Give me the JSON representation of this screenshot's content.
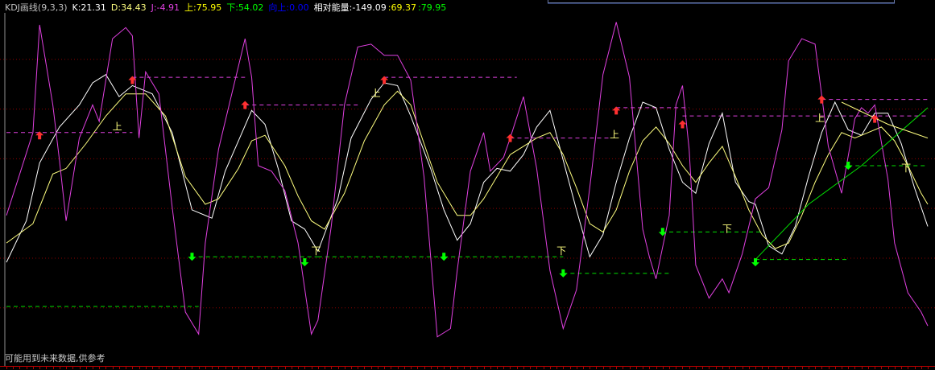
{
  "header": {
    "indicator": "KDJ画线(9,3,3)",
    "k": "K:21.31",
    "d": "D:34.43",
    "j": "J:-4.91",
    "up": "上:75.95",
    "down": "下:54.02",
    "upward": "向上:0.00",
    "rel_energy": "相对能量:-149.09",
    "rel_val2": ":69.37",
    "rel_val3": ":79.95"
  },
  "footer": "可能用到未来数据,供参考",
  "colors": {
    "background": "#000000",
    "header_name": "#c0c0c0",
    "k": "#ffffff",
    "d": "#ffff80",
    "j": "#e040e0",
    "up": "#ffff00",
    "down": "#00ff00",
    "upward": "#0000ff",
    "rel1": "#ffffff",
    "rel2": "#ffff00",
    "rel3": "#00ff00",
    "grid": "#8a0000",
    "peak_marker": "#ff3030",
    "trough_marker": "#00ff00",
    "peak_level": "#e040e0",
    "trough_level": "#00e000",
    "label_text": "#ffff80"
  },
  "chart_data": {
    "type": "line",
    "title": "KDJ画线(9,3,3)",
    "ylim": [
      -16,
      118
    ],
    "grid": true,
    "n_points": 140,
    "gridlines": [
      96.5,
      78.5,
      60.5,
      42.5,
      24.5,
      6.5
    ],
    "series": [
      {
        "name": "K",
        "points": [
          [
            0,
            23
          ],
          [
            3,
            38
          ],
          [
            5,
            59
          ],
          [
            8,
            72
          ],
          [
            11,
            80
          ],
          [
            13,
            88
          ],
          [
            15,
            91
          ],
          [
            17,
            83
          ],
          [
            19,
            87
          ],
          [
            22,
            84
          ],
          [
            25,
            70
          ],
          [
            28,
            42
          ],
          [
            31,
            39
          ],
          [
            33,
            56
          ],
          [
            35,
            67
          ],
          [
            37,
            78
          ],
          [
            39,
            73
          ],
          [
            41,
            57
          ],
          [
            43,
            38
          ],
          [
            45,
            35
          ],
          [
            47,
            27
          ],
          [
            50,
            46
          ],
          [
            52,
            68
          ],
          [
            55,
            82
          ],
          [
            57,
            88
          ],
          [
            59,
            87
          ],
          [
            61,
            76
          ],
          [
            64,
            57
          ],
          [
            66,
            42
          ],
          [
            68,
            31
          ],
          [
            70,
            37
          ],
          [
            72,
            52
          ],
          [
            74,
            57
          ],
          [
            76,
            56
          ],
          [
            78,
            62
          ],
          [
            80,
            72
          ],
          [
            82,
            78
          ],
          [
            84,
            60
          ],
          [
            86,
            42
          ],
          [
            88,
            25
          ],
          [
            90,
            33
          ],
          [
            92,
            52
          ],
          [
            94,
            68
          ],
          [
            96,
            81
          ],
          [
            98,
            79
          ],
          [
            100,
            64
          ],
          [
            102,
            52
          ],
          [
            104,
            48
          ],
          [
            106,
            66
          ],
          [
            108,
            77
          ],
          [
            110,
            52
          ],
          [
            112,
            45
          ],
          [
            113,
            44
          ],
          [
            115,
            29
          ],
          [
            117,
            26
          ],
          [
            119,
            36
          ],
          [
            121,
            54
          ],
          [
            123,
            70
          ],
          [
            125,
            81
          ],
          [
            127,
            71
          ],
          [
            129,
            69
          ],
          [
            131,
            77
          ],
          [
            133,
            77
          ],
          [
            135,
            66
          ],
          [
            137,
            50
          ],
          [
            139,
            36
          ]
        ]
      },
      {
        "name": "D",
        "points": [
          [
            0,
            30
          ],
          [
            4,
            37
          ],
          [
            7,
            55
          ],
          [
            9,
            57
          ],
          [
            12,
            66
          ],
          [
            15,
            76
          ],
          [
            18,
            84
          ],
          [
            21,
            84
          ],
          [
            24,
            76
          ],
          [
            27,
            54
          ],
          [
            30,
            44
          ],
          [
            32,
            46
          ],
          [
            35,
            57
          ],
          [
            37,
            67
          ],
          [
            39,
            69
          ],
          [
            42,
            58
          ],
          [
            44,
            47
          ],
          [
            46,
            38
          ],
          [
            48,
            35
          ],
          [
            51,
            48
          ],
          [
            54,
            67
          ],
          [
            57,
            80
          ],
          [
            59,
            85
          ],
          [
            61,
            80
          ],
          [
            63,
            66
          ],
          [
            65,
            52
          ],
          [
            68,
            40
          ],
          [
            70,
            40
          ],
          [
            72,
            46
          ],
          [
            74,
            54
          ],
          [
            76,
            62
          ],
          [
            78,
            65
          ],
          [
            80,
            68
          ],
          [
            82,
            70
          ],
          [
            84,
            62
          ],
          [
            86,
            50
          ],
          [
            88,
            37
          ],
          [
            90,
            34
          ],
          [
            92,
            42
          ],
          [
            94,
            56
          ],
          [
            96,
            67
          ],
          [
            98,
            72
          ],
          [
            100,
            66
          ],
          [
            102,
            58
          ],
          [
            104,
            52
          ],
          [
            106,
            59
          ],
          [
            108,
            65
          ],
          [
            110,
            54
          ],
          [
            112,
            42
          ],
          [
            114,
            33
          ],
          [
            116,
            28
          ],
          [
            118,
            30
          ],
          [
            120,
            40
          ],
          [
            122,
            52
          ],
          [
            124,
            62
          ],
          [
            126,
            70
          ],
          [
            128,
            68
          ],
          [
            130,
            70
          ],
          [
            132,
            72
          ],
          [
            134,
            67
          ],
          [
            136,
            58
          ],
          [
            138,
            48
          ],
          [
            139,
            44
          ]
        ]
      },
      {
        "name": "J",
        "points": [
          [
            0,
            40
          ],
          [
            2,
            55
          ],
          [
            4,
            70
          ],
          [
            5,
            109
          ],
          [
            7,
            80
          ],
          [
            8,
            60
          ],
          [
            9,
            38
          ],
          [
            11,
            68
          ],
          [
            13,
            80
          ],
          [
            14,
            74
          ],
          [
            16,
            104
          ],
          [
            18,
            108
          ],
          [
            19,
            105
          ],
          [
            20,
            68
          ],
          [
            21,
            92
          ],
          [
            23,
            84
          ],
          [
            25,
            43
          ],
          [
            27,
            5
          ],
          [
            29,
            -3
          ],
          [
            30,
            30
          ],
          [
            32,
            64
          ],
          [
            34,
            84
          ],
          [
            36,
            104
          ],
          [
            37,
            90
          ],
          [
            38,
            58
          ],
          [
            40,
            56
          ],
          [
            42,
            49
          ],
          [
            44,
            30
          ],
          [
            46,
            -3
          ],
          [
            47,
            2
          ],
          [
            49,
            36
          ],
          [
            51,
            80
          ],
          [
            53,
            101
          ],
          [
            55,
            102
          ],
          [
            57,
            98
          ],
          [
            59,
            98
          ],
          [
            61,
            89
          ],
          [
            63,
            54
          ],
          [
            65,
            -4
          ],
          [
            67,
            -1
          ],
          [
            68,
            20
          ],
          [
            70,
            56
          ],
          [
            72,
            70
          ],
          [
            73,
            56
          ],
          [
            75,
            61
          ],
          [
            76,
            68
          ],
          [
            78,
            83
          ],
          [
            80,
            57
          ],
          [
            82,
            20
          ],
          [
            84,
            -1
          ],
          [
            86,
            13
          ],
          [
            88,
            50
          ],
          [
            90,
            91
          ],
          [
            92,
            110
          ],
          [
            94,
            90
          ],
          [
            96,
            35
          ],
          [
            97,
            25
          ],
          [
            98,
            17
          ],
          [
            100,
            40
          ],
          [
            101,
            80
          ],
          [
            102,
            87
          ],
          [
            103,
            64
          ],
          [
            104,
            22
          ],
          [
            106,
            10
          ],
          [
            108,
            17
          ],
          [
            109,
            12
          ],
          [
            111,
            26
          ],
          [
            113,
            46
          ],
          [
            115,
            50
          ],
          [
            117,
            71
          ],
          [
            118,
            96
          ],
          [
            120,
            104
          ],
          [
            122,
            102
          ],
          [
            124,
            65
          ],
          [
            126,
            48
          ],
          [
            128,
            75
          ],
          [
            129,
            79
          ],
          [
            130,
            77
          ],
          [
            131,
            80
          ],
          [
            133,
            53
          ],
          [
            134,
            30
          ],
          [
            136,
            12
          ],
          [
            138,
            5
          ],
          [
            139,
            0
          ]
        ]
      },
      {
        "name": "trend-up",
        "points": [
          [
            113,
            24
          ],
          [
            121,
            44
          ],
          [
            129,
            58
          ],
          [
            139,
            79
          ]
        ]
      },
      {
        "name": "trend-down",
        "points": [
          [
            126,
            81
          ],
          [
            133,
            73
          ],
          [
            139,
            68
          ]
        ]
      }
    ],
    "peak_markers": [
      [
        5,
        69
      ],
      [
        19,
        89
      ],
      [
        36,
        80
      ],
      [
        57,
        89
      ],
      [
        76,
        68
      ],
      [
        92,
        78
      ],
      [
        102,
        73
      ],
      [
        123,
        82
      ],
      [
        131,
        75
      ]
    ],
    "trough_markers": [
      [
        28,
        25
      ],
      [
        45,
        23
      ],
      [
        66,
        25
      ],
      [
        84,
        19
      ],
      [
        99,
        34
      ],
      [
        113,
        23
      ],
      [
        127,
        58
      ]
    ],
    "peak_levels": [
      [
        0,
        19,
        70
      ],
      [
        19,
        36,
        90
      ],
      [
        36,
        53,
        80
      ],
      [
        57,
        77,
        90
      ],
      [
        76,
        91,
        68
      ],
      [
        92,
        103,
        79
      ],
      [
        102,
        139,
        76
      ],
      [
        123,
        139,
        82
      ]
    ],
    "trough_levels": [
      [
        0,
        29,
        7
      ],
      [
        29,
        47,
        25
      ],
      [
        47,
        66,
        25
      ],
      [
        66,
        84,
        25
      ],
      [
        84,
        100,
        19
      ],
      [
        100,
        114,
        34
      ],
      [
        113,
        127,
        24
      ],
      [
        127,
        139,
        58
      ]
    ],
    "labels": [
      {
        "text": "上",
        "at": [
          16,
          71
        ]
      },
      {
        "text": "上",
        "at": [
          55,
          83
        ]
      },
      {
        "text": "上",
        "at": [
          91,
          68
        ]
      },
      {
        "text": "上",
        "at": [
          122,
          74
        ]
      },
      {
        "text": "下",
        "at": [
          46,
          26
        ]
      },
      {
        "text": "下",
        "at": [
          83,
          26
        ]
      },
      {
        "text": "下",
        "at": [
          108,
          34
        ]
      },
      {
        "text": "下",
        "at": [
          135,
          56
        ]
      }
    ]
  }
}
